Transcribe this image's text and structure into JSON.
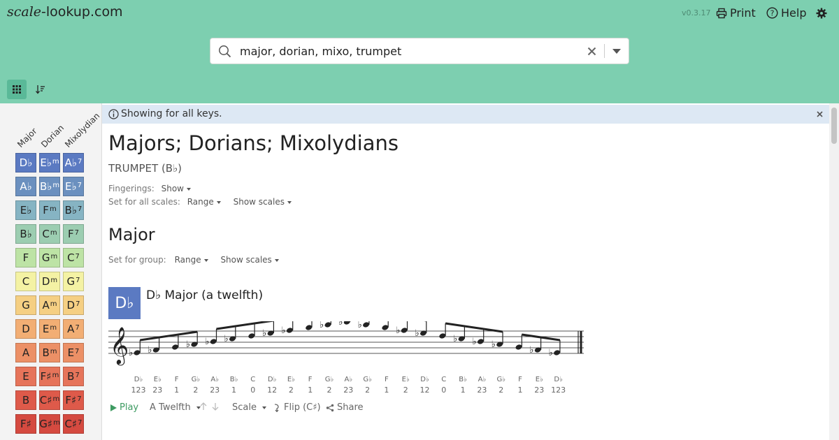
{
  "brand": {
    "logo_italic": "scale",
    "logo_rest": "-lookup.com",
    "version": "v0.3.17"
  },
  "header": {
    "print_label": "Print",
    "help_label": "Help"
  },
  "search": {
    "value": "major, dorian, mixo, trumpet",
    "clear_icon": "close-icon",
    "dropdown_icon": "chevron-down-icon"
  },
  "toolbar": {
    "grid_icon": "grid-icon",
    "sort_icon": "sort-icon"
  },
  "sidebar": {
    "columns": [
      "Major",
      "Dorian",
      "Mixolydian"
    ],
    "rows": [
      {
        "major": "D♭",
        "dorian": "E♭",
        "dorian_sup": "m",
        "mixo": "A♭",
        "mixo_sup": "7",
        "color": "#5b7ac2"
      },
      {
        "major": "A♭",
        "dorian": "B♭",
        "dorian_sup": "m",
        "mixo": "E♭",
        "mixo_sup": "7",
        "color": "#6b90bf"
      },
      {
        "major": "E♭",
        "dorian": "F",
        "dorian_sup": "m",
        "mixo": "B♭",
        "mixo_sup": "7",
        "color": "#86b4c3"
      },
      {
        "major": "B♭",
        "dorian": "C",
        "dorian_sup": "m",
        "mixo": "F",
        "mixo_sup": "7",
        "color": "#9ccdb1"
      },
      {
        "major": "F",
        "dorian": "G",
        "dorian_sup": "m",
        "mixo": "C",
        "mixo_sup": "7",
        "color": "#bde3a5"
      },
      {
        "major": "C",
        "dorian": "D",
        "dorian_sup": "m",
        "mixo": "G",
        "mixo_sup": "7",
        "color": "#f4f2a4"
      },
      {
        "major": "G",
        "dorian": "A",
        "dorian_sup": "m",
        "mixo": "D",
        "mixo_sup": "7",
        "color": "#f5cf83"
      },
      {
        "major": "D",
        "dorian": "E",
        "dorian_sup": "m",
        "mixo": "A",
        "mixo_sup": "7",
        "color": "#f2ae74"
      },
      {
        "major": "A",
        "dorian": "B",
        "dorian_sup": "m",
        "mixo": "E",
        "mixo_sup": "7",
        "color": "#ec9066"
      },
      {
        "major": "E",
        "dorian": "F♯",
        "dorian_sup": "m",
        "mixo": "B",
        "mixo_sup": "7",
        "color": "#e6745a"
      },
      {
        "major": "B",
        "dorian": "C♯",
        "dorian_sup": "m",
        "mixo": "F♯",
        "mixo_sup": "7",
        "color": "#de5a4a"
      },
      {
        "major": "F♯",
        "dorian": "G♯",
        "dorian_sup": "m",
        "mixo": "C♯",
        "mixo_sup": "7",
        "color": "#d54a40"
      }
    ]
  },
  "notice": {
    "text": "Showing for all keys."
  },
  "content": {
    "title": "Majors; Dorians; Mixolydians",
    "instrument": "TRUMPET (B♭)",
    "fingerings_label": "Fingerings:",
    "fingerings_value": "Show",
    "set_all_label": "Set for all scales:",
    "range_label": "Range",
    "show_scales_label": "Show scales",
    "group_title": "Major",
    "set_group_label": "Set for group:",
    "key_badge": "D♭",
    "scale_title": "D♭ Major (a twelfth)",
    "notes": [
      "D♭",
      "E♭",
      "F",
      "G♭",
      "A♭",
      "B♭",
      "C",
      "D♭",
      "E♭",
      "F",
      "G♭",
      "A♭",
      "G♭",
      "F",
      "E♭",
      "D♭",
      "C",
      "B♭",
      "A♭",
      "G♭",
      "F",
      "E♭",
      "D♭"
    ],
    "fingerings": [
      "123",
      "23",
      "1",
      "2",
      "23",
      "1",
      "0",
      "12",
      "2",
      "1",
      "2",
      "23",
      "2",
      "1",
      "2",
      "12",
      "0",
      "1",
      "23",
      "2",
      "1",
      "23",
      "123"
    ],
    "actions": {
      "play": "Play",
      "range": "A Twelfth",
      "scale": "Scale",
      "flip": "Flip (C♯)",
      "share": "Share"
    }
  }
}
